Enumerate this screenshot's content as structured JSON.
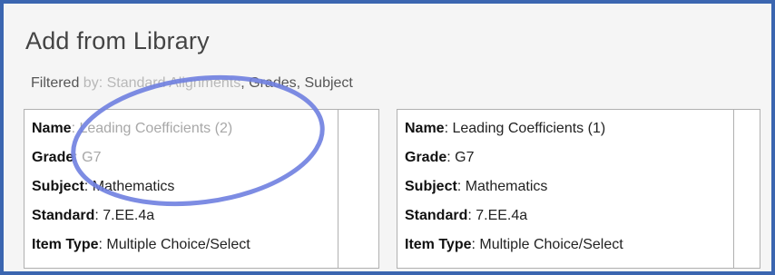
{
  "dialog": {
    "title": "Add from Library",
    "filter_prefix_visible": "Filtered",
    "filter_prefix_faded": " by: Standard Alignments",
    "filter_rest": ", Grades, Subject"
  },
  "cards": [
    {
      "fields": [
        {
          "label": "Name",
          "value": ": Leading Coefficients (2)"
        },
        {
          "label": "Grade",
          "value": ": G7"
        },
        {
          "label": "Subject",
          "value": ": Mathematics"
        },
        {
          "label": "Standard",
          "value": ": 7.EE.4a"
        },
        {
          "label": "Item Type",
          "value": ": Multiple Choice/Select"
        }
      ]
    },
    {
      "fields": [
        {
          "label": "Name",
          "value": ": Leading Coefficients (1)"
        },
        {
          "label": "Grade",
          "value": ": G7"
        },
        {
          "label": "Subject",
          "value": ": Mathematics"
        },
        {
          "label": "Standard",
          "value": ": 7.EE.4a"
        },
        {
          "label": "Item Type",
          "value": ": Multiple Choice/Select"
        }
      ]
    }
  ],
  "colors": {
    "frame_border": "#3b66b0",
    "annotation_ellipse": "#6f7fe0"
  }
}
